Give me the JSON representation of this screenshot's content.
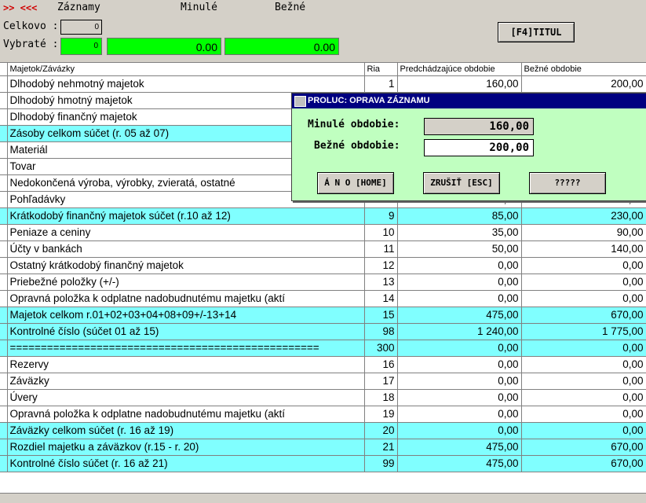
{
  "header": {
    "nav_arrows": ">> <<<",
    "records_label": "Záznamy",
    "previous_label": "Minulé",
    "current_label": "Bežné",
    "total_label": "Celkovo :",
    "total_value": "0",
    "selected_label": "Vybraté :",
    "selected_value": "0",
    "selected_prev": "0.00",
    "selected_curr": "0.00",
    "title_button": "[F4]TITUL"
  },
  "table": {
    "columns": [
      "Majetok/Závázky",
      "Ria",
      "Predchádzajúce obdobie",
      "Bežné obdobie"
    ],
    "rows": [
      {
        "name": "Dlhodobý nehmotný majetok",
        "ria": "1",
        "prev": "160,00",
        "curr": "200,00",
        "hl": false
      },
      {
        "name": "Dlhodobý hmotný majetok",
        "ria": "",
        "prev": "",
        "curr": "",
        "hl": false
      },
      {
        "name": "Dlhodobý finančný majetok",
        "ria": "",
        "prev": "",
        "curr": "",
        "hl": false
      },
      {
        "name": "Zásoby celkom súčet (r. 05 až 07)",
        "ria": "",
        "prev": "",
        "curr": "",
        "hl": true
      },
      {
        "name": "Materiál",
        "ria": "",
        "prev": "",
        "curr": "",
        "hl": false
      },
      {
        "name": "Tovar",
        "ria": "",
        "prev": "",
        "curr": "",
        "hl": false
      },
      {
        "name": "Nedokončená výroba, výrobky, zvieratá, ostatné",
        "ria": "",
        "prev": "",
        "curr": "",
        "hl": false
      },
      {
        "name": "Pohľadávky",
        "ria": "8",
        "prev": "0,00",
        "curr": "0,00",
        "hl": false
      },
      {
        "name": "Krátkodobý finančný majetok súčet (r.10 až 12)",
        "ria": "9",
        "prev": "85,00",
        "curr": "230,00",
        "hl": true
      },
      {
        "name": "Peniaze a ceniny",
        "ria": "10",
        "prev": "35,00",
        "curr": "90,00",
        "hl": false
      },
      {
        "name": "Účty v bankách",
        "ria": "11",
        "prev": "50,00",
        "curr": "140,00",
        "hl": false
      },
      {
        "name": "Ostatný krátkodobý finančný majetok",
        "ria": "12",
        "prev": "0,00",
        "curr": "0,00",
        "hl": false
      },
      {
        "name": "Priebežné položky (+/-)",
        "ria": "13",
        "prev": "0,00",
        "curr": "0,00",
        "hl": false
      },
      {
        "name": "Opravná položka k odplatne nadobudnutému majetku (aktí",
        "ria": "14",
        "prev": "0,00",
        "curr": "0,00",
        "hl": false
      },
      {
        "name": "Majetok celkom r.01+02+03+04+08+09+/-13+14",
        "ria": "15",
        "prev": "475,00",
        "curr": "670,00",
        "hl": true
      },
      {
        "name": "Kontrolné číslo (súčet 01 až 15)",
        "ria": "98",
        "prev": "1 240,00",
        "curr": "1 775,00",
        "hl": true
      },
      {
        "name": "==================================================",
        "ria": "300",
        "prev": "0,00",
        "curr": "0,00",
        "hl": true
      },
      {
        "name": "Rezervy",
        "ria": "16",
        "prev": "0,00",
        "curr": "0,00",
        "hl": false
      },
      {
        "name": "Záväzky",
        "ria": "17",
        "prev": "0,00",
        "curr": "0,00",
        "hl": false
      },
      {
        "name": "Úvery",
        "ria": "18",
        "prev": "0,00",
        "curr": "0,00",
        "hl": false
      },
      {
        "name": "Opravná položka k odplatne nadobudnutému majetku (aktí",
        "ria": "19",
        "prev": "0,00",
        "curr": "0,00",
        "hl": false
      },
      {
        "name": "Záväzky celkom súčet (r. 16 až 19)",
        "ria": "20",
        "prev": "0,00",
        "curr": "0,00",
        "hl": true
      },
      {
        "name": "Rozdiel majetku a záväzkov (r.15 - r. 20)",
        "ria": "21",
        "prev": "475,00",
        "curr": "670,00",
        "hl": true
      },
      {
        "name": "Kontrolné číslo súčet (r. 16 až 21)",
        "ria": "99",
        "prev": "475,00",
        "curr": "670,00",
        "hl": true
      }
    ]
  },
  "dialog": {
    "title": "PROLUC: OPRAVA ZÁZNAMU",
    "prev_label": "Minulé obdobie:",
    "prev_value": "160,00",
    "curr_label": "Bežné obdobie:",
    "curr_value": "200,00",
    "yes_button": "Á N O [HOME]",
    "cancel_button": "ZRUŠIŤ [ESC]",
    "help_button": "?????"
  }
}
